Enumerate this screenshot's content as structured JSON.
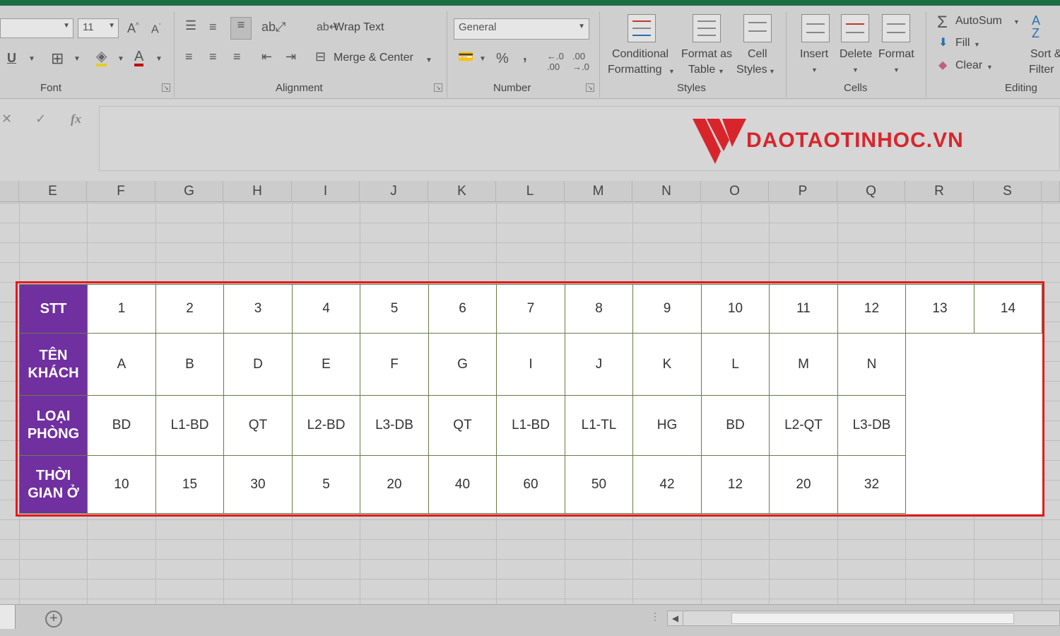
{
  "ribbon": {
    "font": {
      "size_value": "11",
      "group_label": "Font"
    },
    "alignment": {
      "wrap_text_label": "Wrap Text",
      "merge_center_label": "Merge & Center",
      "group_label": "Alignment"
    },
    "number": {
      "format_value": "General",
      "percent": "%",
      "comma": ",",
      "group_label": "Number"
    },
    "styles": {
      "conditional_formatting_line1": "Conditional",
      "conditional_formatting_line2": "Formatting",
      "format_as_table_line1": "Format as",
      "format_as_table_line2": "Table",
      "cell_styles_line1": "Cell",
      "cell_styles_line2": "Styles",
      "group_label": "Styles"
    },
    "cells": {
      "insert_label": "Insert",
      "delete_label": "Delete",
      "format_label": "Format",
      "group_label": "Cells"
    },
    "editing": {
      "autosum_label": "AutoSum",
      "fill_label": "Fill",
      "clear_label": "Clear",
      "sort_line1": "Sort &",
      "sort_line2": "Filter",
      "group_label": "Editing"
    }
  },
  "formula_bar": {
    "cancel_symbol": "✕",
    "enter_symbol": "✓",
    "fx_label": "fx"
  },
  "logo": {
    "text": "DAOTAOTINHOC.VN",
    "brand_color": "#d8252c"
  },
  "columns": [
    "E",
    "F",
    "G",
    "H",
    "I",
    "J",
    "K",
    "L",
    "M",
    "N",
    "O",
    "P",
    "Q",
    "R",
    "S"
  ],
  "table": {
    "header_color": "#7030a0",
    "border_highlight_color": "#e21b1b",
    "rows": [
      {
        "header_line1": "STT",
        "header_line2": "",
        "cells": [
          "1",
          "2",
          "3",
          "4",
          "5",
          "6",
          "7",
          "8",
          "9",
          "10",
          "11",
          "12",
          "13",
          "14"
        ]
      },
      {
        "header_line1": "TÊN",
        "header_line2": "KHÁCH",
        "cells": [
          "A",
          "B",
          "D",
          "E",
          "F",
          "G",
          "I",
          "J",
          "K",
          "L",
          "M",
          "N",
          "",
          ""
        ]
      },
      {
        "header_line1": "LOẠI",
        "header_line2": "PHÒNG",
        "cells": [
          "BD",
          "L1-BD",
          "QT",
          "L2-BD",
          "L3-DB",
          "QT",
          "L1-BD",
          "L1-TL",
          "HG",
          "BD",
          "L2-QT",
          "L3-DB",
          "",
          ""
        ]
      },
      {
        "header_line1": "THỜI",
        "header_line2": "GIAN Ở",
        "cells": [
          "10",
          "15",
          "30",
          "5",
          "20",
          "40",
          "60",
          "50",
          "42",
          "12",
          "20",
          "32",
          "",
          ""
        ]
      }
    ]
  },
  "bottom": {
    "add_sheet_symbol": "+"
  }
}
